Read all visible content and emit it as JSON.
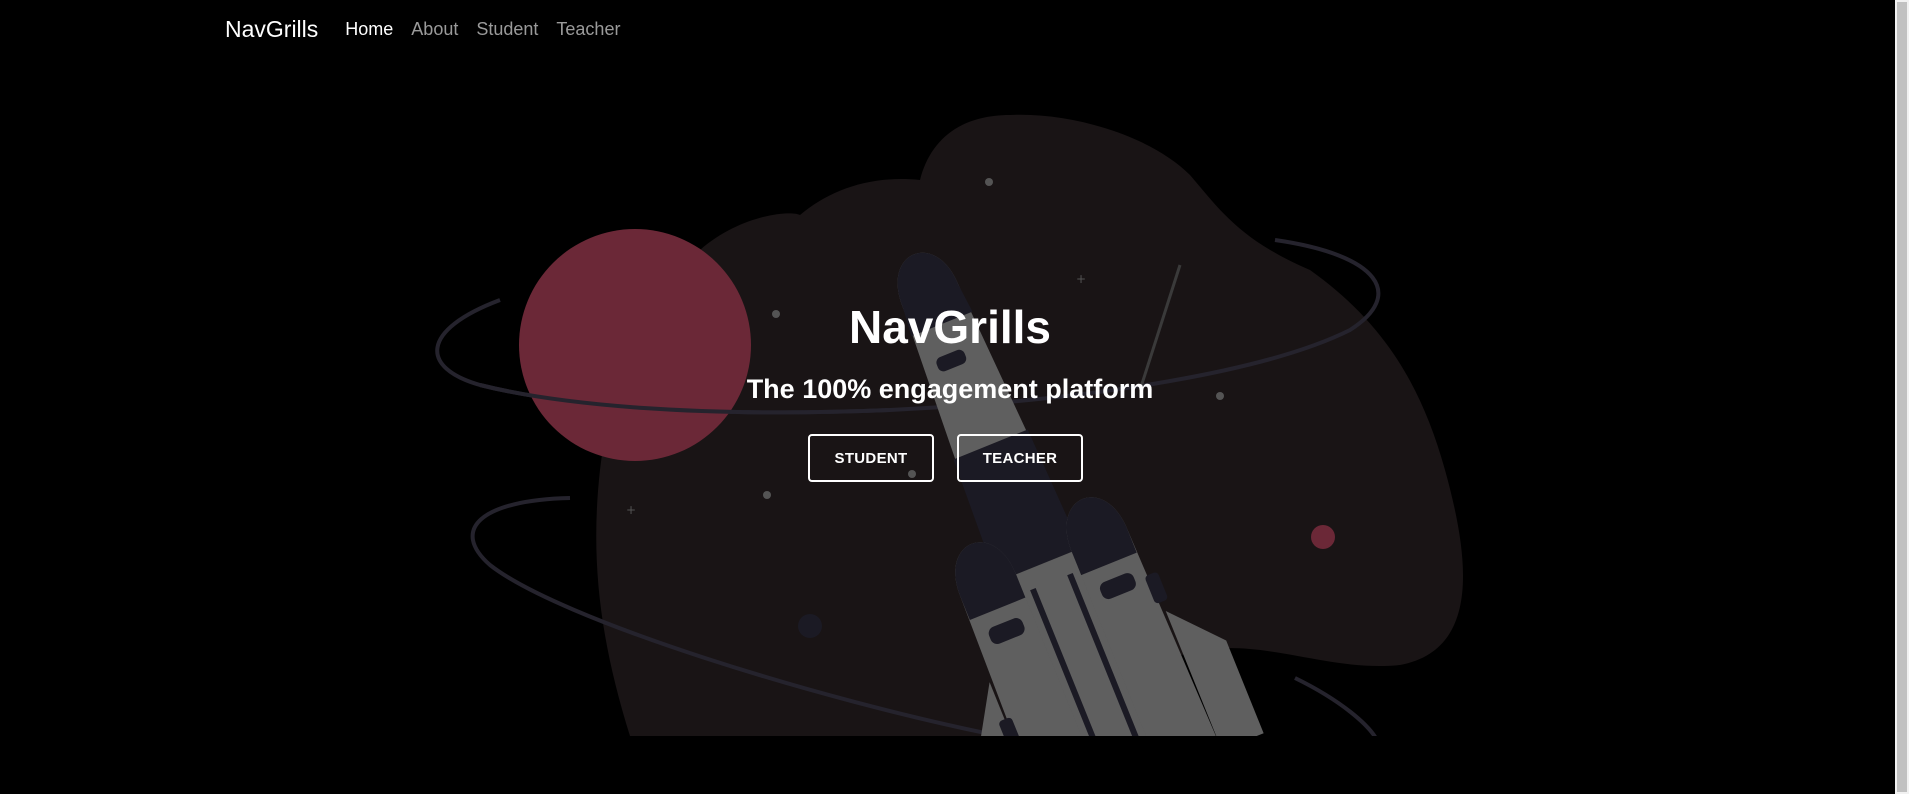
{
  "navbar": {
    "brand": "NavGrills",
    "links": [
      {
        "label": "Home",
        "active": true
      },
      {
        "label": "About",
        "active": false
      },
      {
        "label": "Student",
        "active": false
      },
      {
        "label": "Teacher",
        "active": false
      }
    ]
  },
  "hero": {
    "title": "NavGrills",
    "subtitle": "The 100% engagement platform",
    "buttons": {
      "student": "STUDENT",
      "teacher": "TEACHER"
    }
  },
  "illustration": {
    "icon": "rocket-launch-illustration",
    "colors": {
      "background": "#000000",
      "blob": "#191415",
      "planet": "#6b2837",
      "rocket_body": "#5f5f5f",
      "rocket_dark": "#1b1a24",
      "orbit": "#25232d",
      "dot": "#545454"
    }
  }
}
